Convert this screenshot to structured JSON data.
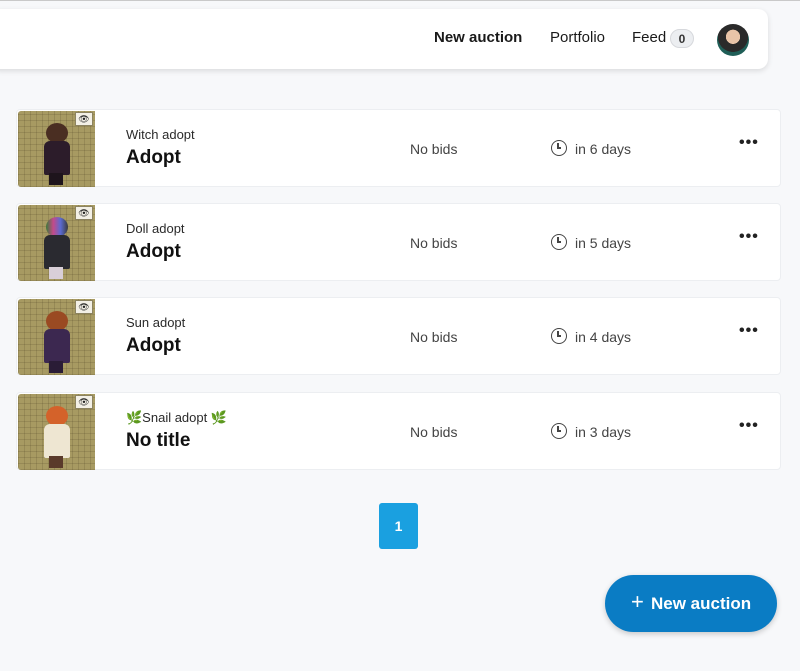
{
  "header": {
    "new_auction": "New auction",
    "portfolio": "Portfolio",
    "feed": "Feed",
    "feed_count": "0"
  },
  "listings": [
    {
      "subtitle": "Witch adopt",
      "title": "Adopt",
      "bids": "No bids",
      "time_left": "in 6 days"
    },
    {
      "subtitle": "Doll adopt",
      "title": "Adopt",
      "bids": "No bids",
      "time_left": "in 5 days"
    },
    {
      "subtitle": "Sun adopt",
      "title": "Adopt",
      "bids": "No bids",
      "time_left": "in 4 days"
    },
    {
      "subtitle": "🌿Snail adopt 🌿",
      "title": "No title",
      "bids": "No bids",
      "time_left": "in 3 days"
    }
  ],
  "pagination": {
    "current_page": "1"
  },
  "fab": {
    "label": "New auction",
    "icon": "plus-icon"
  },
  "icons": {
    "clock": "clock-icon",
    "more": "more-icon",
    "eye": "eye-icon"
  },
  "colors": {
    "accent": "#1aa0e0",
    "fab": "#0a7cc4",
    "background": "#f7f8fa"
  }
}
